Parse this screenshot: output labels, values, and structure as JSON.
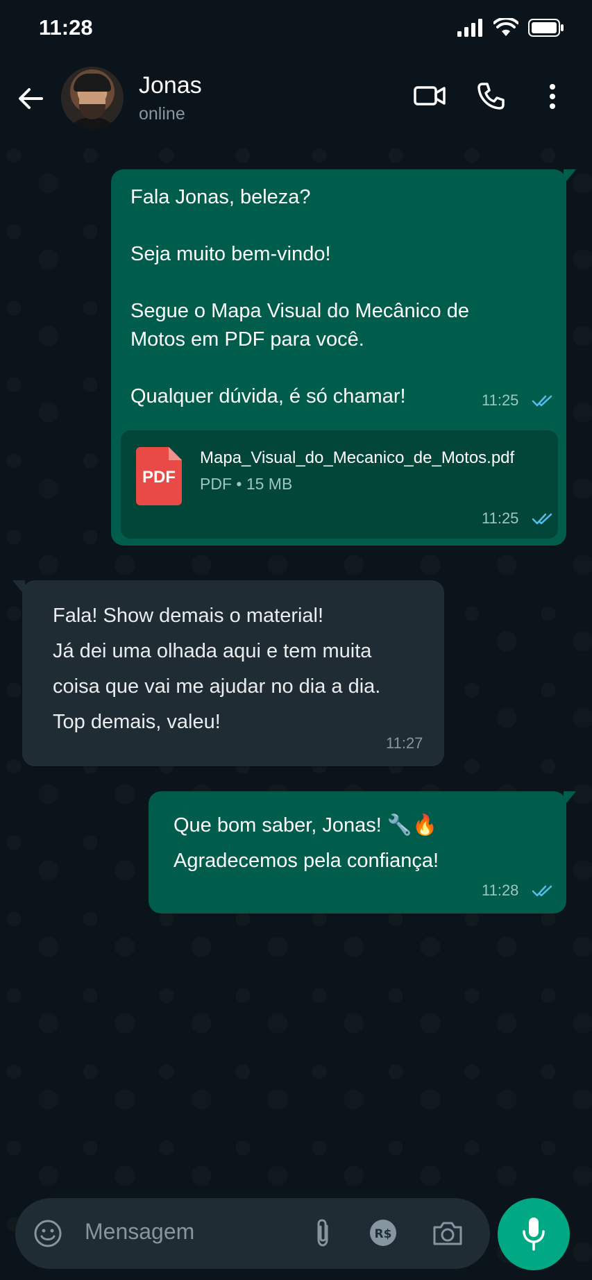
{
  "status_bar": {
    "time": "11:28"
  },
  "header": {
    "contact_name": "Jonas",
    "contact_status": "online",
    "icons": [
      "back-arrow-icon",
      "video-call-icon",
      "phone-icon",
      "more-options-icon"
    ]
  },
  "messages": [
    {
      "direction": "outgoing",
      "text": "Fala Jonas, beleza?\n\nSeja muito bem-vindo!\n\nSegue o Mapa Visual do Mecânico de\nMotos em PDF para você.\n\nQualquer dúvida, é só chamar!",
      "time": "11:25",
      "read": true
    },
    {
      "direction": "outgoing",
      "type": "document",
      "file_name": "Mapa_Visual_do_Mecanico_de_Motos.pdf",
      "file_meta": "PDF • 15 MB",
      "file_badge": "PDF",
      "time": "11:25",
      "read": true
    },
    {
      "direction": "incoming",
      "text": "Fala! Show demais o material!\nJá dei uma olhada aqui e tem muita\ncoisa que vai me ajudar no dia a dia.\nTop demais, valeu!",
      "time": "11:27"
    },
    {
      "direction": "outgoing",
      "text": "Que bom saber, Jonas! 🔧🔥\nAgradecemos pela confiança!",
      "time": "11:28",
      "read": true
    }
  ],
  "composer": {
    "placeholder": "Mensagem",
    "icons": [
      "emoji-icon",
      "attach-icon",
      "payment-icon",
      "camera-icon",
      "mic-icon"
    ]
  },
  "colors": {
    "background": "#0b141a",
    "outgoing_bubble": "#005c4b",
    "incoming_bubble": "#202c33",
    "read_ticks": "#53bdeb",
    "accent": "#00a884",
    "pdf_red": "#e94a45"
  }
}
